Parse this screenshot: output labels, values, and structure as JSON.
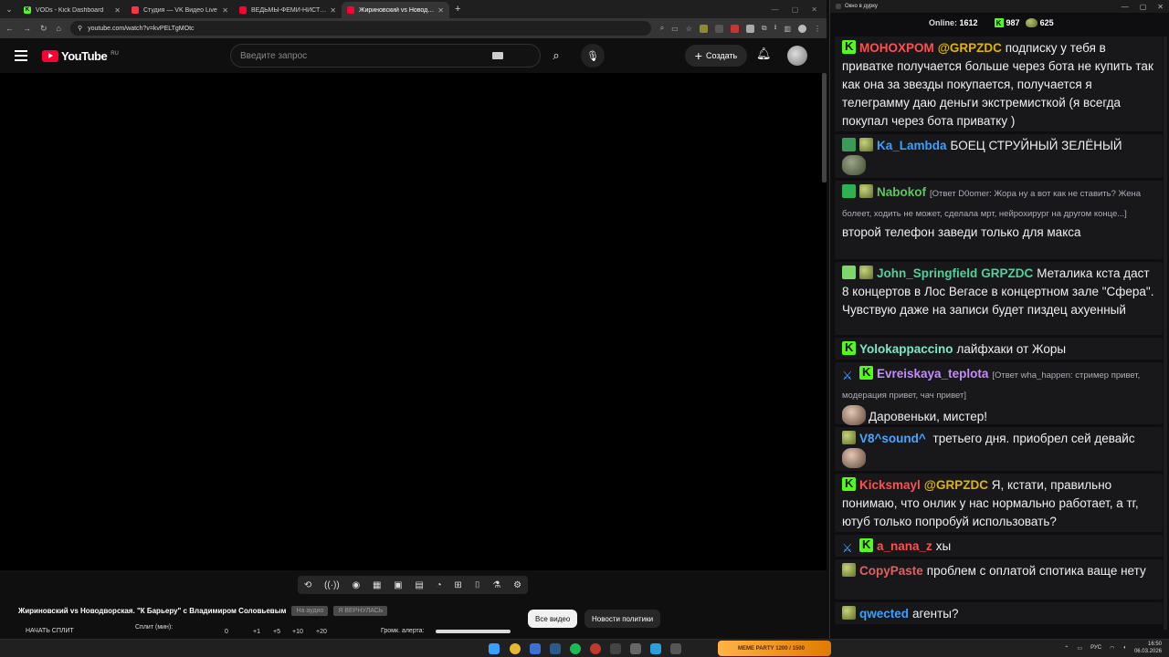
{
  "browser": {
    "tabs": [
      {
        "title": "VODs - Kick Dashboard",
        "favicon_color": "#53fc18",
        "favicon_letter": "K"
      },
      {
        "title": "Студия — VK Видео Live",
        "favicon_color": "#ff3347",
        "favicon_letter": ""
      },
      {
        "title": "ВЕДЬМЫ-ФЕМИ-НИСТКИ ПРОТ",
        "favicon_color": "#ff0033",
        "favicon_letter": ""
      },
      {
        "title": "Жириновский vs Новодворская",
        "favicon_color": "#ff0033",
        "favicon_letter": ""
      }
    ],
    "url": "youtube.com/watch?v=kvPELTgMOtc"
  },
  "youtube": {
    "logo_text": "YouTube",
    "logo_region": "RU",
    "search_placeholder": "Введите запрос",
    "create_label": "Создать",
    "video_title": "Жириновский vs Новодворская. \"К Барьеру\" с Владимиром Соловьевым",
    "chips": [
      "На аудио",
      "Я ВЕРНУЛАСЬ"
    ],
    "pills": [
      "Все видео",
      "Новости политики"
    ],
    "split": {
      "start_label": "НАЧАТЬ СПЛИТ",
      "minutes_label": "Сплит (мин):",
      "values": [
        "0",
        "+1",
        "+5",
        "+10",
        "+20"
      ],
      "alert_label": "Громк. алерта:"
    }
  },
  "chat": {
    "window_title": "Окно в дурку",
    "online_label": "Online:",
    "online_count": "1612",
    "kick_count": "987",
    "other_count": "625",
    "messages": [
      {
        "user": "MOHOXPOM",
        "color": "#ff4f4f",
        "mention": "@GRPZDC",
        "text": "подписку у тебя в приватке получается больше через бота не купить так как она за звезды покупается, получается я телеграмму даю деньги экстремисткой (я всегда покупал через бота приватку )"
      },
      {
        "user": "Ka_Lambda",
        "color": "#3aa0ff",
        "mention": "",
        "text": "БОЕЦ СТРУЙНЫЙ ЗЕЛЁНЫЙ"
      },
      {
        "user": "Nabokof",
        "color": "#5cc75c",
        "reply": "[Ответ D0omer: Жора ну а вот как не ставить? Жена болеет, ходить не может, сделала мрт, нейрохирург на другом конце...]",
        "mention": "",
        "text": "второй телефон заведи только для макса"
      },
      {
        "user": "John_Springfield",
        "color": "#4fd19a",
        "mention": "GRPZDC",
        "text": "Металика кста даст 8 концертов в Лос Вегасе в концертном зале \"Сфера\". Чувствую даже на записи будет пиздец ахуенный"
      },
      {
        "user": "Yolokappaccino",
        "color": "#7fe7c5",
        "mention": "",
        "text": "лайфхаки от Жоры"
      },
      {
        "user": "Evreiskaya_teplota",
        "color": "#c48cff",
        "reply": "[Ответ wha_happen: стример привет, модерация привет, чач привет]",
        "mention": "",
        "text": "Даровеньки, мистер!"
      },
      {
        "user": "V8^sound^",
        "color": "#4aa6ff",
        "mention": "",
        "text": "третьего дня. приобрел сей девайс"
      },
      {
        "user": "Kicksmayl",
        "color": "#ff4f4f",
        "mention": "@GRPZDC",
        "text": "Я, кстати, правильно понимаю, что онлик у нас нормально работает, а тг, ютуб только попробуй использовать?"
      },
      {
        "user": "a_nana_z",
        "color": "#ff4f4f",
        "mention": "",
        "text": "хы"
      },
      {
        "user": "CopyPaste",
        "color": "#e06060",
        "mention": "",
        "text": "проблем с оплатой спотика ваще нету"
      },
      {
        "user": "qwected",
        "color": "#3aa0ff",
        "mention": "",
        "text": "агенты?"
      }
    ]
  },
  "taskbar": {
    "widget_text": "MEME PARTY",
    "widget_sub": "1200 / 1500",
    "lang": "РУС",
    "time": "16:50",
    "date": "06.03.2026"
  }
}
